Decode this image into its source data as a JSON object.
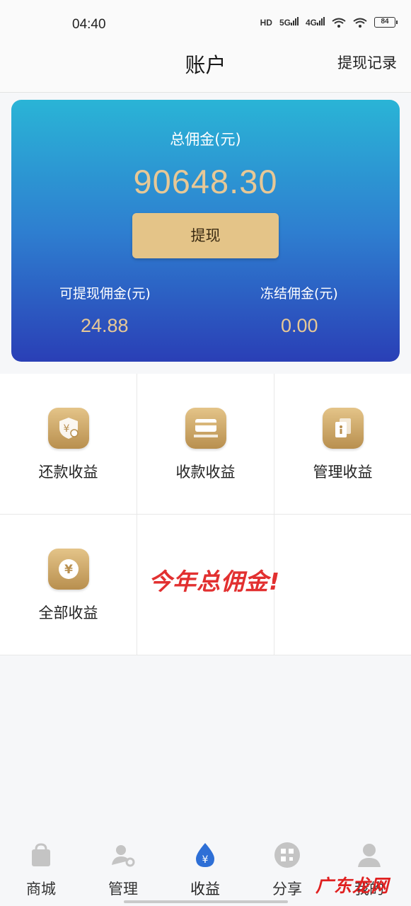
{
  "status_bar": {
    "time": "04:40",
    "hd": "HD",
    "net1": "5G",
    "net2": "4G",
    "battery": "84"
  },
  "header": {
    "title": "账户",
    "withdraw_record": "提现记录"
  },
  "card": {
    "total_label": "总佣金(元)",
    "total_value": "90648.30",
    "withdraw_button": "提现",
    "withdrawable_label": "可提现佣金(元)",
    "withdrawable_value": "24.88",
    "frozen_label": "冻结佣金(元)",
    "frozen_value": "0.00",
    "accent_color": "#e7c896"
  },
  "grid": {
    "items": [
      {
        "label": "还款收益",
        "icon": "shield-yen-icon"
      },
      {
        "label": "收款收益",
        "icon": "card-icon"
      },
      {
        "label": "管理收益",
        "icon": "documents-icon"
      },
      {
        "label": "全部收益",
        "icon": "yen-coin-icon"
      }
    ]
  },
  "overlay_text": "今年总佣金!",
  "tabbar": {
    "tabs": [
      {
        "label": "商城",
        "icon": "shopping-bag-icon",
        "active": false
      },
      {
        "label": "管理",
        "icon": "user-manage-icon",
        "active": false
      },
      {
        "label": "收益",
        "icon": "yen-drop-icon",
        "active": true
      },
      {
        "label": "分享",
        "icon": "qr-code-icon",
        "active": false
      },
      {
        "label": "我的",
        "icon": "profile-icon",
        "active": false
      }
    ]
  },
  "watermark": "广东龙网"
}
